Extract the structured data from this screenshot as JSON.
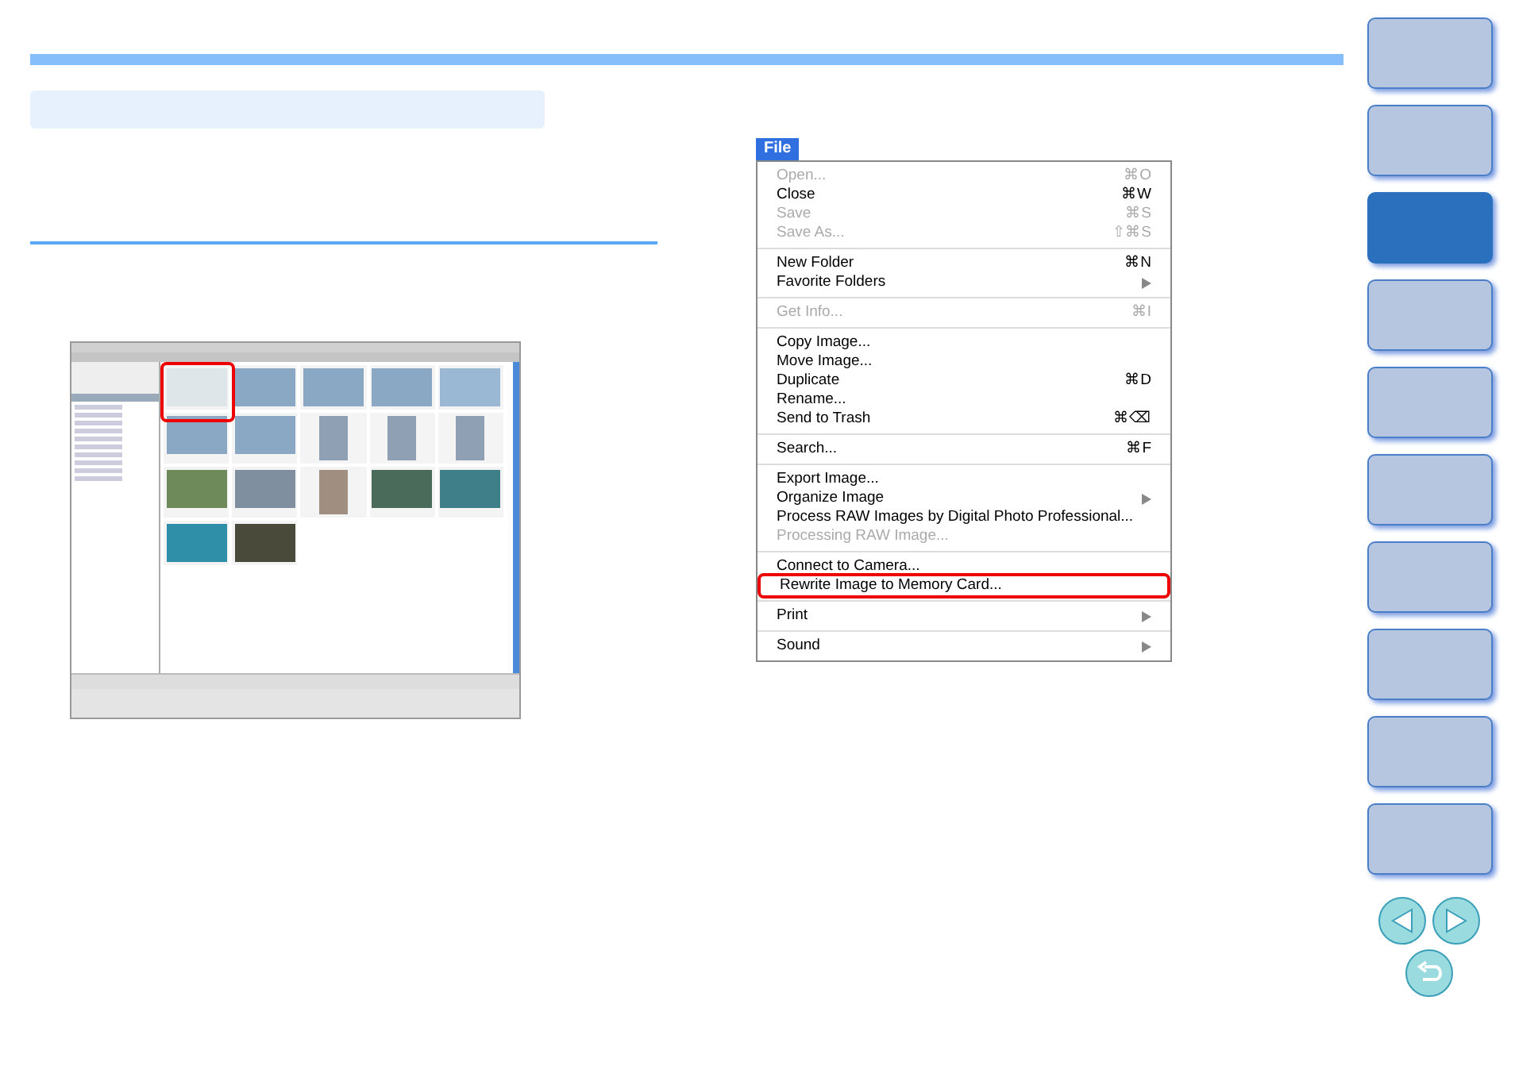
{
  "menu": {
    "title": "File",
    "groups": [
      [
        {
          "label": "Open...",
          "shortcut": "⌘O",
          "disabled": true,
          "submenu": false,
          "highlighted": false
        },
        {
          "label": "Close",
          "shortcut": "⌘W",
          "disabled": false,
          "submenu": false,
          "highlighted": false
        },
        {
          "label": "Save",
          "shortcut": "⌘S",
          "disabled": true,
          "submenu": false,
          "highlighted": false
        },
        {
          "label": "Save As...",
          "shortcut": "⇧⌘S",
          "disabled": true,
          "submenu": false,
          "highlighted": false
        }
      ],
      [
        {
          "label": "New Folder",
          "shortcut": "⌘N",
          "disabled": false,
          "submenu": false,
          "highlighted": false
        },
        {
          "label": "Favorite Folders",
          "disabled": false,
          "submenu": true,
          "highlighted": false
        }
      ],
      [
        {
          "label": "Get Info...",
          "shortcut": "⌘I",
          "disabled": true,
          "submenu": false,
          "highlighted": false
        }
      ],
      [
        {
          "label": "Copy Image...",
          "disabled": false,
          "submenu": false,
          "highlighted": false
        },
        {
          "label": "Move Image...",
          "disabled": false,
          "submenu": false,
          "highlighted": false
        },
        {
          "label": "Duplicate",
          "shortcut": "⌘D",
          "disabled": false,
          "submenu": false,
          "highlighted": false
        },
        {
          "label": "Rename...",
          "disabled": false,
          "submenu": false,
          "highlighted": false
        },
        {
          "label": "Send to Trash",
          "shortcut": "⌘⌫",
          "disabled": false,
          "submenu": false,
          "highlighted": false
        }
      ],
      [
        {
          "label": "Search...",
          "shortcut": "⌘F",
          "disabled": false,
          "submenu": false,
          "highlighted": false
        }
      ],
      [
        {
          "label": "Export Image...",
          "disabled": false,
          "submenu": false,
          "highlighted": false
        },
        {
          "label": "Organize Image",
          "disabled": false,
          "submenu": true,
          "highlighted": false
        },
        {
          "label": "Process RAW Images by Digital Photo Professional...",
          "disabled": false,
          "submenu": false,
          "highlighted": false
        },
        {
          "label": "Processing RAW Image...",
          "disabled": true,
          "submenu": false,
          "highlighted": false
        }
      ],
      [
        {
          "label": "Connect to Camera...",
          "disabled": false,
          "submenu": false,
          "highlighted": false
        },
        {
          "label": "Rewrite Image to Memory Card...",
          "disabled": false,
          "submenu": false,
          "highlighted": true
        }
      ],
      [
        {
          "label": "Print",
          "disabled": false,
          "submenu": true,
          "highlighted": false
        }
      ],
      [
        {
          "label": "Sound",
          "disabled": false,
          "submenu": true,
          "highlighted": false
        }
      ]
    ]
  },
  "nav": {
    "buttons": [
      {
        "selected": false
      },
      {
        "selected": false
      },
      {
        "selected": true
      },
      {
        "selected": false
      },
      {
        "selected": false
      },
      {
        "selected": false
      },
      {
        "selected": false
      },
      {
        "selected": false
      },
      {
        "selected": false
      },
      {
        "selected": false
      }
    ]
  }
}
